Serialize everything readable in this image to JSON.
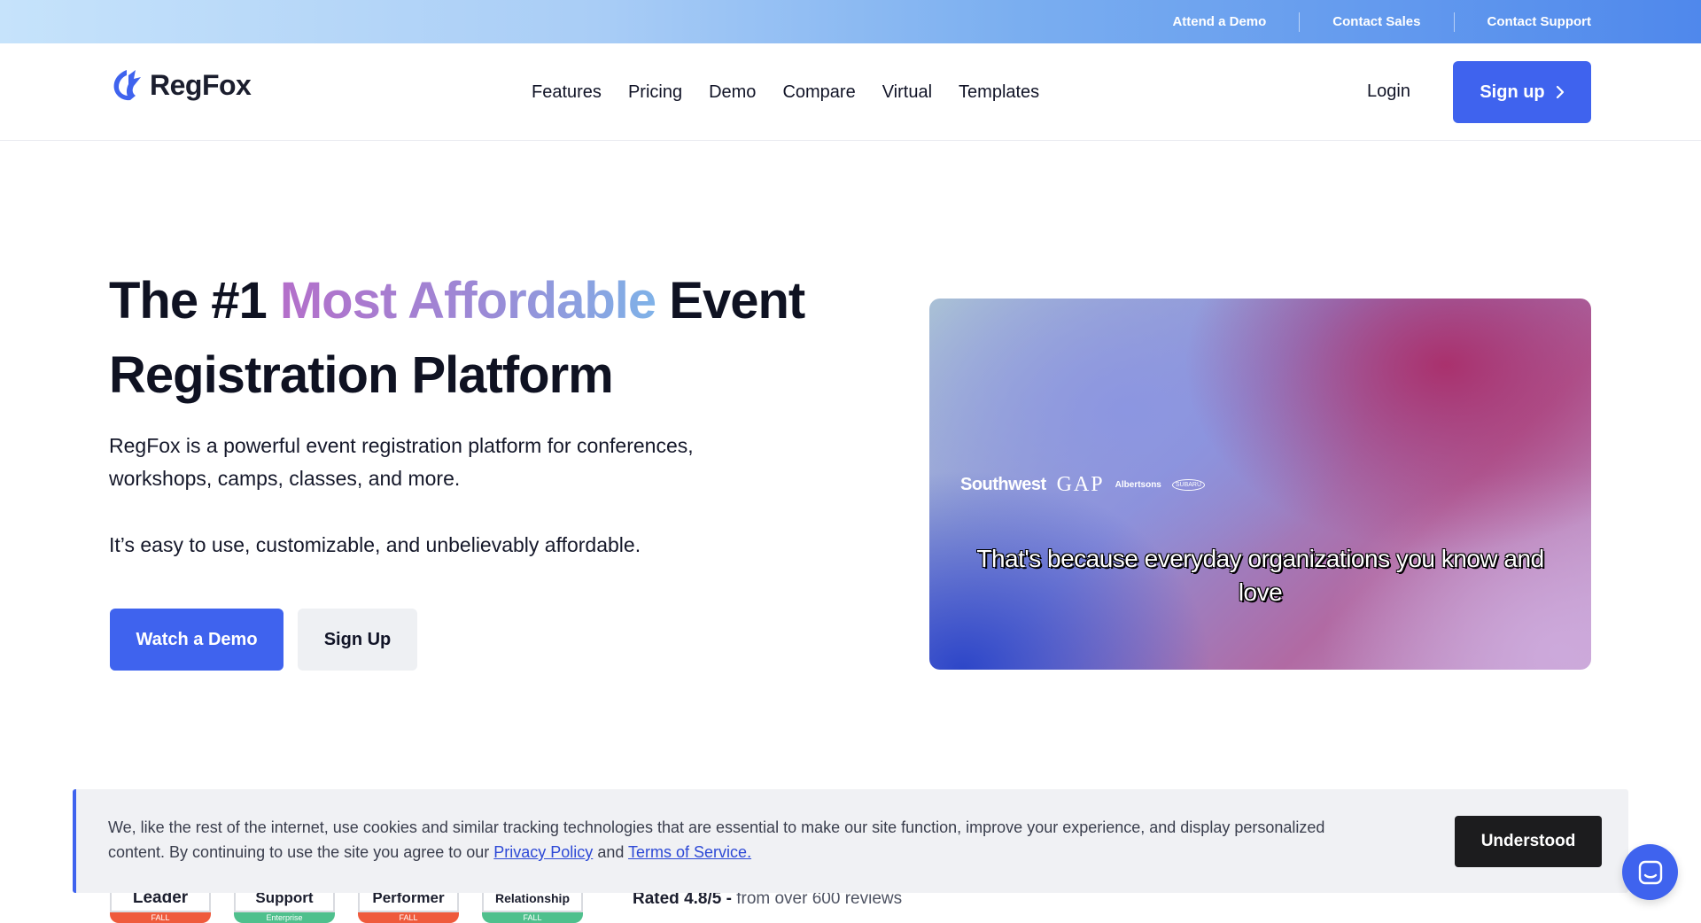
{
  "topbar": {
    "links": [
      "Attend a Demo",
      "Contact Sales",
      "Contact Support"
    ]
  },
  "nav": {
    "logo_text": "RegFox",
    "links": [
      "Features",
      "Pricing",
      "Demo",
      "Compare",
      "Virtual",
      "Templates"
    ],
    "login": "Login",
    "signup": "Sign up"
  },
  "hero": {
    "title_part1": "The #1 ",
    "title_highlight": "Most Affordable",
    "title_part2": " Event Registration Platform",
    "description": "RegFox is a powerful event registration platform for conferences, workshops, camps, classes, and more.",
    "description2": "It’s easy to use, customizable, and unbelievably affordable.",
    "watch_demo": "Watch a Demo",
    "sign_up": "Sign Up"
  },
  "video": {
    "brands": [
      "Southwest",
      "GAP",
      "Albertsons",
      "SUBARU"
    ],
    "caption": "That's because everyday organizations you know and love"
  },
  "badges": [
    {
      "label": "Leader",
      "sub": "FALL",
      "color": "#ef5a3c"
    },
    {
      "label": "Support",
      "sub": "Enterprise",
      "color": "#4fc08d"
    },
    {
      "label": "Performer",
      "sub": "FALL",
      "color": "#ef5a3c"
    },
    {
      "label": "Relationship",
      "sub": "FALL",
      "color": "#4fc08d"
    }
  ],
  "rating": {
    "rated": "Rated 4.8/5 -",
    "reviews": " from over 600 reviews"
  },
  "cookie": {
    "text": "We, like the rest of the internet, use cookies and similar tracking technologies that are essential to make our site function, improve your experience, and display personalized content. By continuing to use the site you agree to our ",
    "privacy": "Privacy Policy",
    "and": " and ",
    "terms": "Terms of Service.",
    "button": "Understood"
  },
  "colors": {
    "primary": "#3f63ee",
    "dark": "#0f1222"
  }
}
